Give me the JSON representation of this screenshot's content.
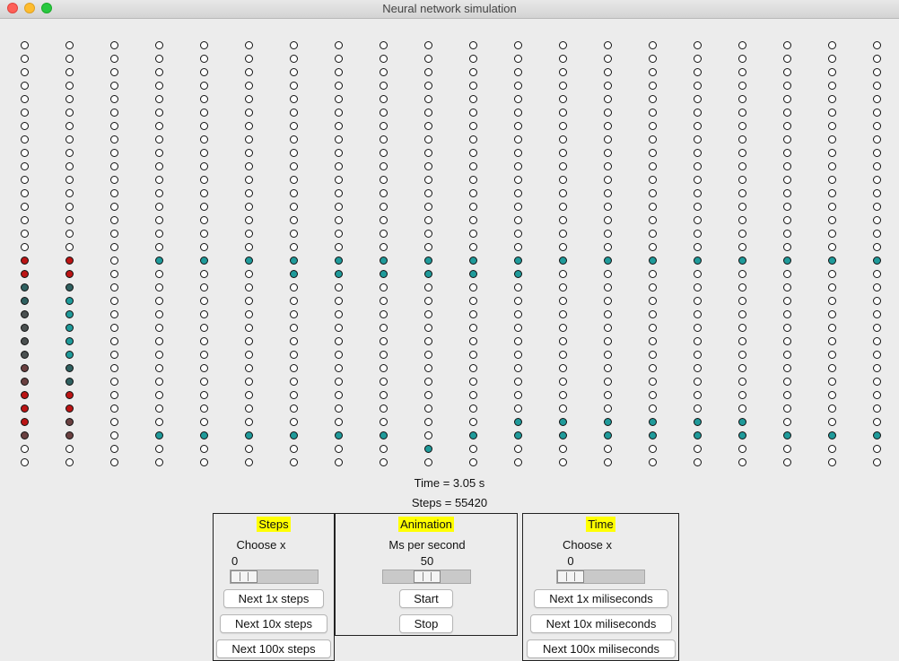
{
  "window": {
    "title": "Neural network simulation"
  },
  "colors": {
    "inactive": "#ffffff",
    "teal": "#1f9a9a",
    "red": "#bb1414",
    "dark_teal": "#2f6060",
    "dark_gray": "#4a5050",
    "brown": "#6a4040"
  },
  "grid": {
    "columns": 20,
    "rows": 32,
    "cells": [
      "................................",
      "................................",
      "................................",
      "................................",
      "................................",
      "................................",
      "................................",
      "................................",
      "................................",
      "................................",
      "................................",
      "................................",
      "................................",
      "................................",
      "................................",
      "................................",
      "................................",
      "................................",
      "................................",
      "................................",
      "................................",
      "................................",
      "................................",
      "................................",
      "................................",
      "................................",
      "................................",
      "................................",
      "................................",
      "................................",
      "................................",
      "................................"
    ],
    "pattern": [
      "................................",
      "................................"
    ]
  },
  "status": {
    "time": "Time = 3.05 s",
    "steps": "Steps = 55420"
  },
  "steps_panel": {
    "title": "Steps",
    "choose_label": "Choose x",
    "value": "0",
    "slider_fraction": 0,
    "btn_1x": "Next 1x steps",
    "btn_10x": "Next 10x steps",
    "btn_100x": "Next 100x steps"
  },
  "animation_panel": {
    "title": "Animation",
    "rate_label": "Ms per second",
    "value": "50",
    "slider_fraction": 0.5,
    "start": "Start",
    "stop": "Stop"
  },
  "time_panel": {
    "title": "Time",
    "choose_label": "Choose x",
    "value": "0",
    "slider_fraction": 0,
    "btn_1x": "Next 1x miliseconds",
    "btn_10x": "Next 10x miliseconds",
    "btn_100x": "Next 100x miliseconds"
  }
}
